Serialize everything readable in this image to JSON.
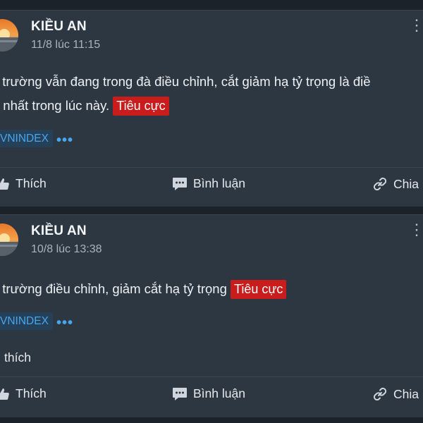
{
  "posts": [
    {
      "author": "KIỀU AN",
      "time": "11/8 lúc 11:15",
      "content_line1": "ị trường vẫn đang trong đà điều chỉnh, cắt giảm hạ tỷ trọng là điề",
      "content_line2": "t nhất trong lúc này.",
      "sentiment": "Tiêu cực",
      "tag": "VNINDEX",
      "likes_text": "",
      "actions": {
        "like": "Thích",
        "comment": "Bình luận",
        "share": "Chia"
      }
    },
    {
      "author": "KIỀU AN",
      "time": "10/8 lúc 13:38",
      "content_line1": "ị trường điều chỉnh, giảm cắt hạ tỷ trọng",
      "content_line2": "",
      "sentiment": "Tiêu cực",
      "tag": "VNINDEX",
      "likes_text": "thích",
      "actions": {
        "like": "Thích",
        "comment": "Bình luận",
        "share": "Chia"
      }
    }
  ],
  "colors": {
    "background": "#1c2229",
    "card": "#2c3742",
    "negative_badge": "#c91c1c",
    "tag_text": "#48a6ee",
    "tag_bg": "#25415a"
  },
  "icons": {
    "like": "thumbs-up-icon",
    "comment": "comment-icon",
    "share": "link-icon",
    "more": "more-dots-icon"
  }
}
